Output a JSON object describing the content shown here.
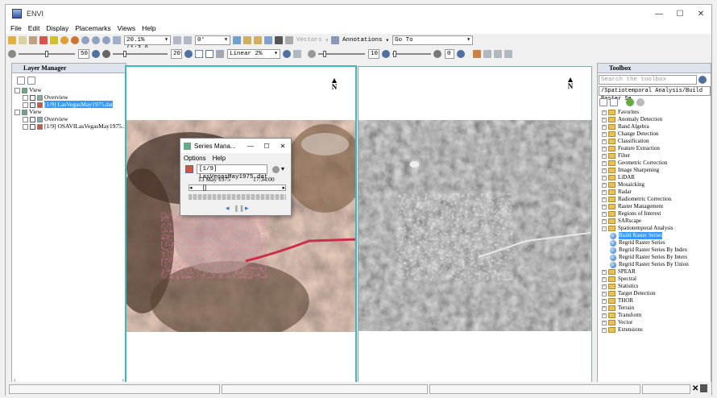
{
  "app": {
    "title": "ENVI"
  },
  "window_buttons": {
    "minimize": "—",
    "maximize": "☐",
    "close": "✕"
  },
  "menu": [
    "File",
    "Edit",
    "Display",
    "Placemarks",
    "Views",
    "Help"
  ],
  "toolbar1": {
    "zoom_value": "20.1% (1:3.6...",
    "rotation_value": "0°",
    "vectors_label": "Vectors",
    "annotations_label": "Annotations",
    "goto_value": "Go To"
  },
  "toolbar2": {
    "brightness_value": "50",
    "contrast_value": "20",
    "stretch_value": "Linear 2%",
    "sharpen_value": "10",
    "transparency_value": "0"
  },
  "layer_manager": {
    "title": "Layer Manager",
    "tree": [
      {
        "label": "View",
        "level": 0
      },
      {
        "label": "Overview",
        "level": 1
      },
      {
        "label": "[1/9] LasVegasMay1975.dat",
        "level": 1,
        "selected": true
      },
      {
        "label": "View",
        "level": 0
      },
      {
        "label": "Overview",
        "level": 1
      },
      {
        "label": "[1/9] OSAVILasVegasMay1975...",
        "level": 1
      }
    ]
  },
  "views": {
    "north_label": "N"
  },
  "series_dialog": {
    "title": "Series Mana...",
    "menu": [
      "Options",
      "Help"
    ],
    "file_value": "[1/9] LasVegasMay1975.dat",
    "date": "13 May 1975",
    "time": "17:34:00",
    "progress": 0.08
  },
  "toolbox": {
    "title": "Toolbox",
    "search_placeholder": "Search the toolbox",
    "path": "/Spatiotemporal Analysis/Build Raster Se",
    "items": [
      {
        "label": "Favorites",
        "type": "folder",
        "level": 0
      },
      {
        "label": "Anomaly Detection",
        "type": "folder",
        "level": 0
      },
      {
        "label": "Band Algebra",
        "type": "folder",
        "level": 0
      },
      {
        "label": "Change Detection",
        "type": "folder",
        "level": 0
      },
      {
        "label": "Classification",
        "type": "folder",
        "level": 0
      },
      {
        "label": "Feature Extraction",
        "type": "folder",
        "level": 0
      },
      {
        "label": "Filter",
        "type": "folder",
        "level": 0
      },
      {
        "label": "Geometric Correction",
        "type": "folder",
        "level": 0
      },
      {
        "label": "Image Sharpening",
        "type": "folder",
        "level": 0
      },
      {
        "label": "LiDAR",
        "type": "folder",
        "level": 0
      },
      {
        "label": "Mosaicking",
        "type": "folder",
        "level": 0
      },
      {
        "label": "Radar",
        "type": "folder",
        "level": 0
      },
      {
        "label": "Radiometric Correction",
        "type": "folder",
        "level": 0
      },
      {
        "label": "Raster Management",
        "type": "folder",
        "level": 0
      },
      {
        "label": "Regions of Interest",
        "type": "folder",
        "level": 0
      },
      {
        "label": "SARscape",
        "type": "folder",
        "level": 0
      },
      {
        "label": "Spatiotemporal Analysis",
        "type": "folder",
        "level": 0,
        "expanded": true
      },
      {
        "label": "Build Raster Series",
        "type": "tool",
        "level": 1,
        "selected": true
      },
      {
        "label": "Regrid Raster Series",
        "type": "tool",
        "level": 1
      },
      {
        "label": "Regrid Raster Series By Index",
        "type": "tool",
        "level": 1
      },
      {
        "label": "Regrid Raster Series By Inters",
        "type": "tool",
        "level": 1
      },
      {
        "label": "Regrid Raster Series By Union",
        "type": "tool",
        "level": 1
      },
      {
        "label": "SPEAR",
        "type": "folder",
        "level": 0
      },
      {
        "label": "Spectral",
        "type": "folder",
        "level": 0
      },
      {
        "label": "Statistics",
        "type": "folder",
        "level": 0
      },
      {
        "label": "Target Detection",
        "type": "folder",
        "level": 0
      },
      {
        "label": "THOR",
        "type": "folder",
        "level": 0
      },
      {
        "label": "Terrain",
        "type": "folder",
        "level": 0
      },
      {
        "label": "Transform",
        "type": "folder",
        "level": 0
      },
      {
        "label": "Vector",
        "type": "folder",
        "level": 0
      },
      {
        "label": "Extensions",
        "type": "folder",
        "level": 0
      }
    ]
  },
  "colors": {
    "accent": "#3399ff",
    "view_border": "#3bb8c0",
    "folder": "#e8c258"
  }
}
